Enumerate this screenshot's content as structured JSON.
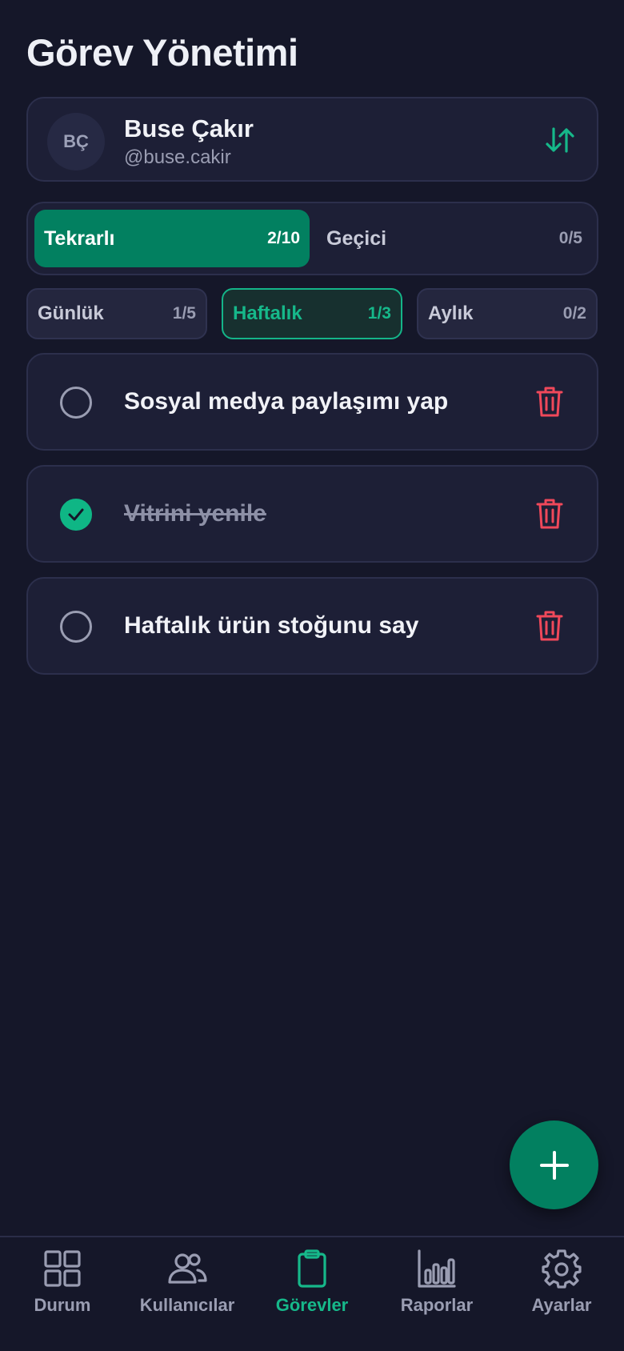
{
  "page": {
    "title": "Görev Yönetimi"
  },
  "user": {
    "initials": "BÇ",
    "name": "Buse Çakır",
    "handle": "@buse.cakir"
  },
  "task_types": [
    {
      "label": "Tekrarlı",
      "count": "2/10",
      "active": true
    },
    {
      "label": "Geçici",
      "count": "0/5",
      "active": false
    }
  ],
  "frequencies": [
    {
      "label": "Günlük",
      "count": "1/5",
      "active": false
    },
    {
      "label": "Haftalık",
      "count": "1/3",
      "active": true
    },
    {
      "label": "Aylık",
      "count": "0/2",
      "active": false
    }
  ],
  "tasks": [
    {
      "text": "Sosyal medya paylaşımı yap",
      "done": false
    },
    {
      "text": "Vitrini yenile",
      "done": true
    },
    {
      "text": "Haftalık ürün stoğunu say",
      "done": false
    }
  ],
  "nav": [
    {
      "label": "Durum",
      "icon": "grid-icon",
      "active": false
    },
    {
      "label": "Kullanıcılar",
      "icon": "users-icon",
      "active": false
    },
    {
      "label": "Görevler",
      "icon": "clipboard-icon",
      "active": true
    },
    {
      "label": "Raporlar",
      "icon": "bar-chart-icon",
      "active": false
    },
    {
      "label": "Ayarlar",
      "icon": "gear-icon",
      "active": false
    }
  ],
  "colors": {
    "background": "#151729",
    "accent": "#028060",
    "accent_text": "#16b88a",
    "danger": "#f0485a"
  }
}
